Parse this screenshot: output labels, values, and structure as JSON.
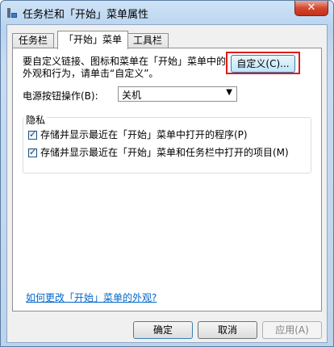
{
  "window": {
    "title": "任务栏和「开始」菜单属性",
    "close_label": "✕"
  },
  "tabs": [
    {
      "label": "任务栏"
    },
    {
      "label": "「开始」菜单"
    },
    {
      "label": "工具栏"
    }
  ],
  "start_menu": {
    "intro_line1": "要自定义链接、图标和菜单在「开始」菜单中的",
    "intro_line2": "外观和行为，请单击“自定义”。",
    "customize_button": "自定义(C)...",
    "power_label": "电源按钮操作(B):",
    "power_value": "关机",
    "privacy": {
      "title": "隐私",
      "options": [
        {
          "label": "存储并显示最近在「开始」菜单中打开的程序(P)",
          "checked": true
        },
        {
          "label": "存储并显示最近在「开始」菜单和任务栏中打开的项目(M)",
          "checked": true
        }
      ]
    },
    "help_link": "如何更改「开始」菜单的外观?"
  },
  "footer": {
    "ok": "确定",
    "cancel": "取消",
    "apply": "应用(A)"
  }
}
